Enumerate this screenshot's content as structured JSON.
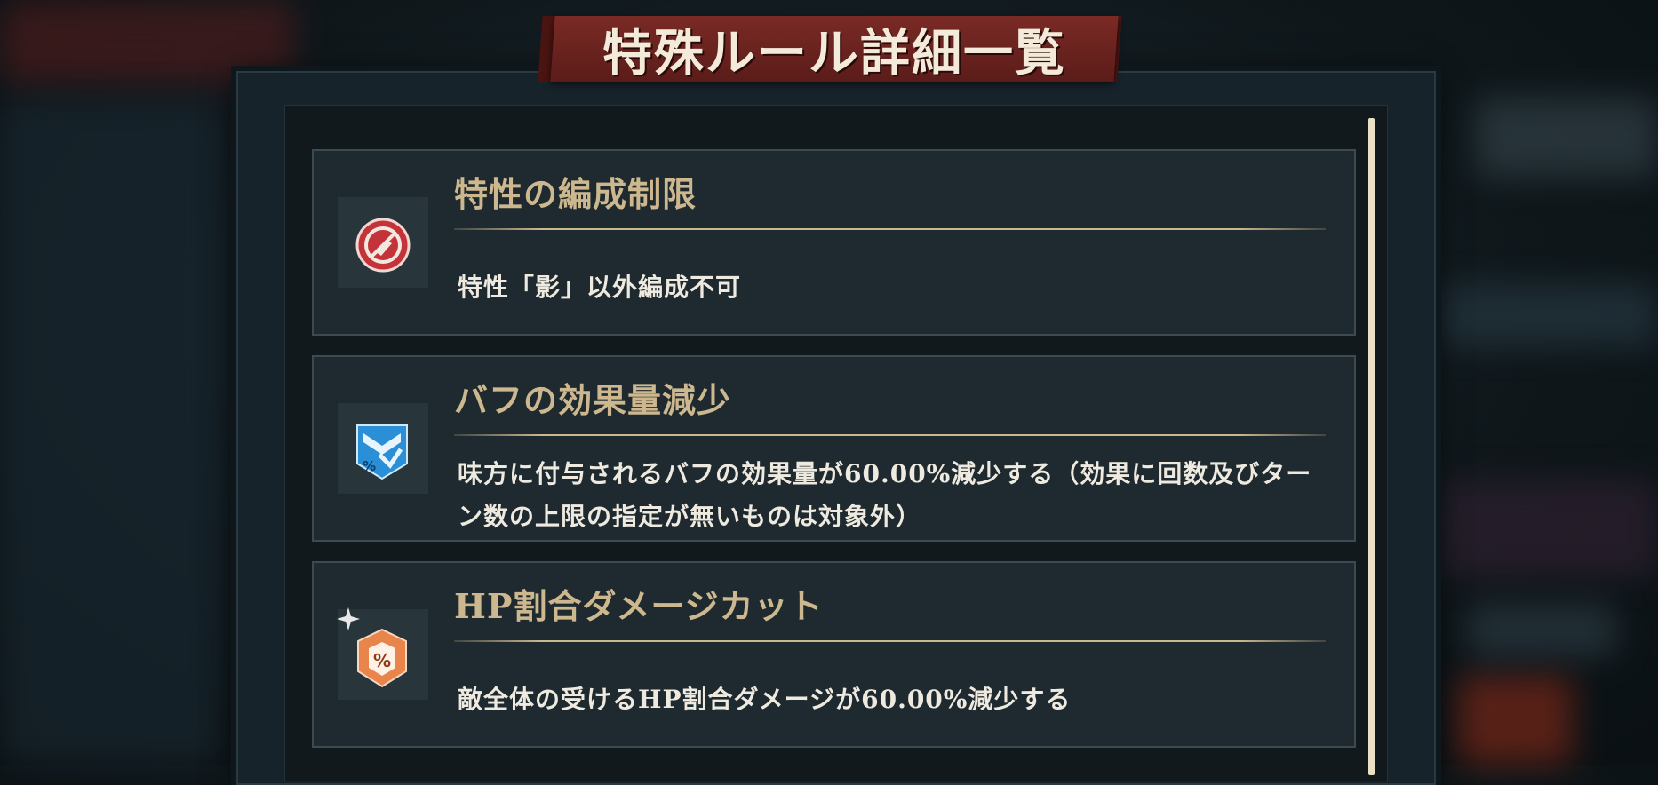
{
  "header": {
    "title": "特殊ルール詳細一覧"
  },
  "rules": [
    {
      "title": "特性の編成制限",
      "description": "特性「影」以外編成不可",
      "icon": "no-formation-icon",
      "icon_color": "#c4323a"
    },
    {
      "title": "バフの効果量減少",
      "description": "味方に付与されるバフの効果量が60.00%減少する（効果に回数及びターン数の上限の指定が無いものは対象外）",
      "icon": "buff-down-icon",
      "icon_color": "#2a8fd6",
      "icon_text": "%"
    },
    {
      "title": "HP割合ダメージカット",
      "description": "敵全体の受けるHP割合ダメージが60.00%減少する",
      "icon": "percent-shield-icon",
      "icon_color": "#e9844a",
      "icon_text": "%"
    }
  ]
}
